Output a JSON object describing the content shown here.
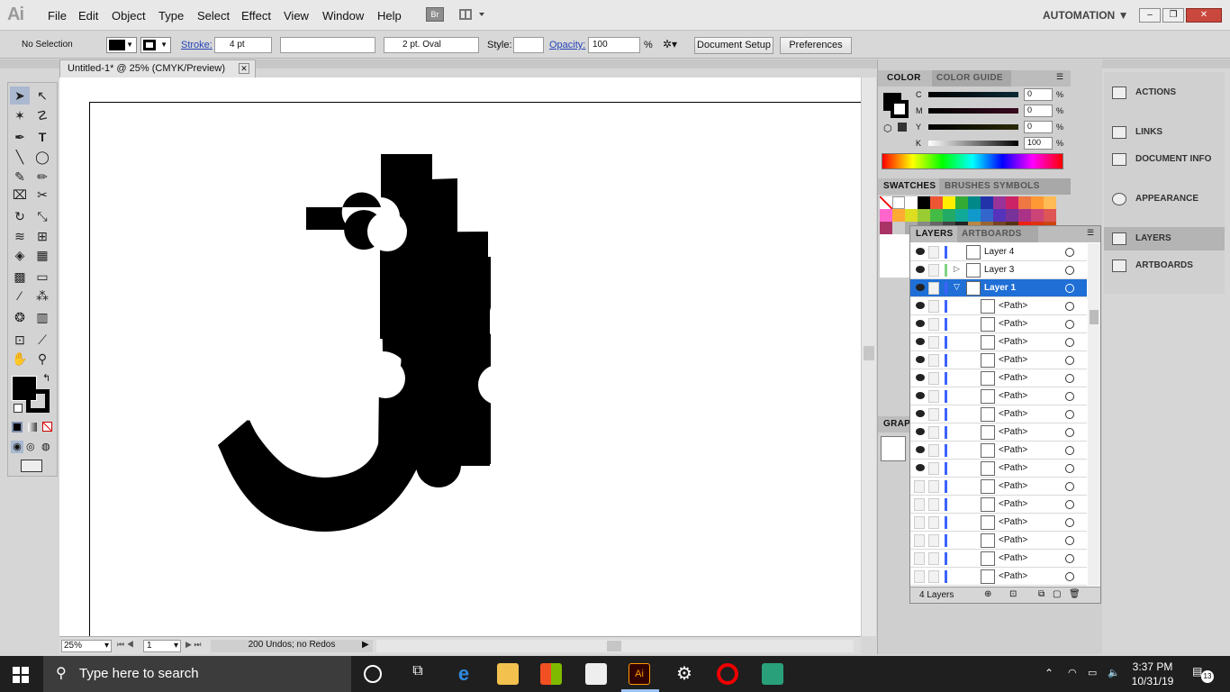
{
  "app": {
    "logo": "Ai",
    "workspace": "AUTOMATION"
  },
  "menu": [
    "File",
    "Edit",
    "Object",
    "Type",
    "Select",
    "Effect",
    "View",
    "Window",
    "Help"
  ],
  "bridge_label": "Br",
  "window_buttons": {
    "minimize": "–",
    "restore": "❐",
    "close": "✕"
  },
  "control": {
    "selection": "No Selection",
    "stroke_label": "Stroke:",
    "stroke_value": "4 pt",
    "brush": "2 pt. Oval",
    "style_label": "Style:",
    "opacity_label": "Opacity:",
    "opacity_value": "100",
    "opacity_unit": "%",
    "document_setup": "Document Setup",
    "preferences": "Preferences"
  },
  "document": {
    "tab_title": "Untitled-1* @ 25% (CMYK/Preview)",
    "zoom": "25%",
    "artboard_num": "1",
    "status": "200 Undos; no Redos"
  },
  "color_panel": {
    "tabs": [
      "COLOR",
      "COLOR GUIDE"
    ],
    "channels": [
      {
        "label": "C",
        "value": "0",
        "unit": "%"
      },
      {
        "label": "M",
        "value": "0",
        "unit": "%"
      },
      {
        "label": "Y",
        "value": "0",
        "unit": "%"
      },
      {
        "label": "K",
        "value": "100",
        "unit": "%"
      }
    ]
  },
  "swatch_tabs": [
    "SWATCHES",
    "BRUSHES",
    "SYMBOLS"
  ],
  "graphic_tab": "GRAP",
  "layers_panel": {
    "tabs": [
      "LAYERS",
      "ARTBOARDS"
    ],
    "layers": [
      {
        "name": "Layer 4",
        "selected": false,
        "indent": 0,
        "color": "#3c62ff"
      },
      {
        "name": "Layer 3",
        "selected": false,
        "indent": 0,
        "color": "#7fd27f"
      },
      {
        "name": "Layer 1",
        "selected": true,
        "indent": 0,
        "color": "#3c62ff"
      },
      {
        "name": "<Path>",
        "selected": false,
        "indent": 1,
        "color": "#3c62ff"
      },
      {
        "name": "<Path>",
        "selected": false,
        "indent": 1,
        "color": "#3c62ff"
      },
      {
        "name": "<Path>",
        "selected": false,
        "indent": 1,
        "color": "#3c62ff"
      },
      {
        "name": "<Path>",
        "selected": false,
        "indent": 1,
        "color": "#3c62ff"
      },
      {
        "name": "<Path>",
        "selected": false,
        "indent": 1,
        "color": "#3c62ff"
      },
      {
        "name": "<Path>",
        "selected": false,
        "indent": 1,
        "color": "#3c62ff"
      },
      {
        "name": "<Path>",
        "selected": false,
        "indent": 1,
        "color": "#3c62ff"
      },
      {
        "name": "<Path>",
        "selected": false,
        "indent": 1,
        "color": "#3c62ff"
      },
      {
        "name": "<Path>",
        "selected": false,
        "indent": 1,
        "color": "#3c62ff"
      },
      {
        "name": "<Path>",
        "selected": false,
        "indent": 1,
        "color": "#3c62ff"
      },
      {
        "name": "<Path>",
        "selected": false,
        "indent": 1,
        "color": "#3c62ff"
      },
      {
        "name": "<Path>",
        "selected": false,
        "indent": 1,
        "color": "#3c62ff"
      },
      {
        "name": "<Path>",
        "selected": false,
        "indent": 1,
        "color": "#3c62ff"
      },
      {
        "name": "<Path>",
        "selected": false,
        "indent": 1,
        "color": "#3c62ff"
      },
      {
        "name": "<Path>",
        "selected": false,
        "indent": 1,
        "color": "#3c62ff"
      },
      {
        "name": "<Path>",
        "selected": false,
        "indent": 1,
        "color": "#3c62ff"
      }
    ],
    "count": "4 Layers"
  },
  "dock": [
    "ACTIONS",
    "LINKS",
    "DOCUMENT INFO",
    "APPEARANCE",
    "LAYERS",
    "ARTBOARDS"
  ],
  "taskbar": {
    "search_placeholder": "Type here to search",
    "time": "3:37 PM",
    "date": "10/31/19",
    "notifications": "13"
  }
}
